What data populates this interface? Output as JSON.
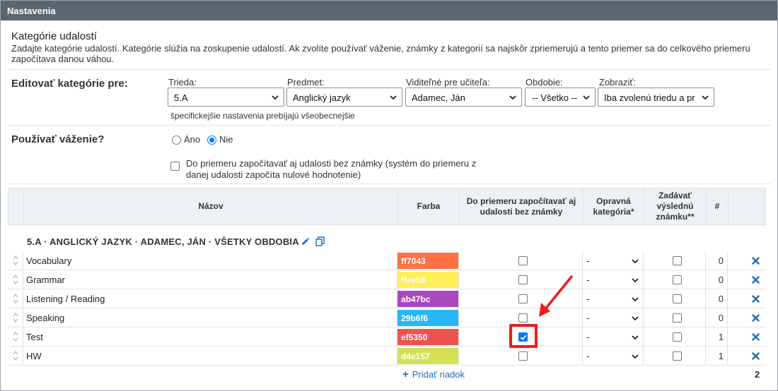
{
  "window": {
    "title": "Nastavenia"
  },
  "section": {
    "title": "Kategórie udalostí",
    "description": "Zadajte kategórie udalostí. Kategórie slúžia na zoskupenie udalostí. Ak zvolíte používať váženie, známky z kategorií sa najskôr zpriemerujú a tento priemer sa do celkového priemeru započítava danou váhou."
  },
  "edit": {
    "label": "Editovať kategórie pre:",
    "fields": [
      {
        "label": "Trieda:",
        "value": "5.A"
      },
      {
        "label": "Predmet:",
        "value": "Anglický jazyk"
      },
      {
        "label": "Viditeľné pre učiteľa:",
        "value": "Adamec, Ján"
      },
      {
        "label": "Obdobie:",
        "value": "-- Všetko --"
      },
      {
        "label": "Zobraziť:",
        "value": "Iba zvolenú triedu a pr"
      }
    ],
    "hint": "špecifickejšie nastavenia prebíjajú všeobecnejšie"
  },
  "weighting": {
    "label": "Používať váženie?",
    "options": [
      {
        "label": "Áno",
        "selected": false
      },
      {
        "label": "Nie",
        "selected": true
      }
    ],
    "include_checkbox": {
      "checked": false,
      "label": "Do priemeru započítavať aj udalosti bez známky (systém do priemeru z danej udalosti započíta nulové hodnotenie)"
    }
  },
  "table": {
    "headers": {
      "name": "Názov",
      "color": "Farba",
      "include": "Do priemeru započítavať aj udalosti bez známky",
      "corrective": "Opravná kategória*",
      "final": "Zadávať výslednú známku**",
      "count": "#"
    },
    "group_title": "5.A · ANGLICKÝ JAZYK · ADAMEC, JÁN · VŠETKY OBDOBIA",
    "rows": [
      {
        "name": "Vocabulary",
        "color": "ff7043",
        "include": false,
        "corrective": "-",
        "final": false,
        "count": "0"
      },
      {
        "name": "Grammar",
        "color": "ffee58",
        "include": false,
        "corrective": "-",
        "final": false,
        "count": "0"
      },
      {
        "name": "Listening / Reading",
        "color": "ab47bc",
        "include": false,
        "corrective": "-",
        "final": false,
        "count": "0"
      },
      {
        "name": "Speaking",
        "color": "29b6f6",
        "include": false,
        "corrective": "-",
        "final": false,
        "count": "0"
      },
      {
        "name": "Test",
        "color": "ef5350",
        "include": true,
        "corrective": "-",
        "final": false,
        "count": "1"
      },
      {
        "name": "HW",
        "color": "d4e157",
        "include": false,
        "corrective": "-",
        "final": false,
        "count": "1"
      }
    ],
    "add_row_label": "Pridať riadok",
    "total": "2"
  },
  "colors": {
    "titlebar": "#5b6670",
    "link": "#1e6db8",
    "checkbox_on": "#0075ff",
    "annotation": "#ee1c1c"
  }
}
